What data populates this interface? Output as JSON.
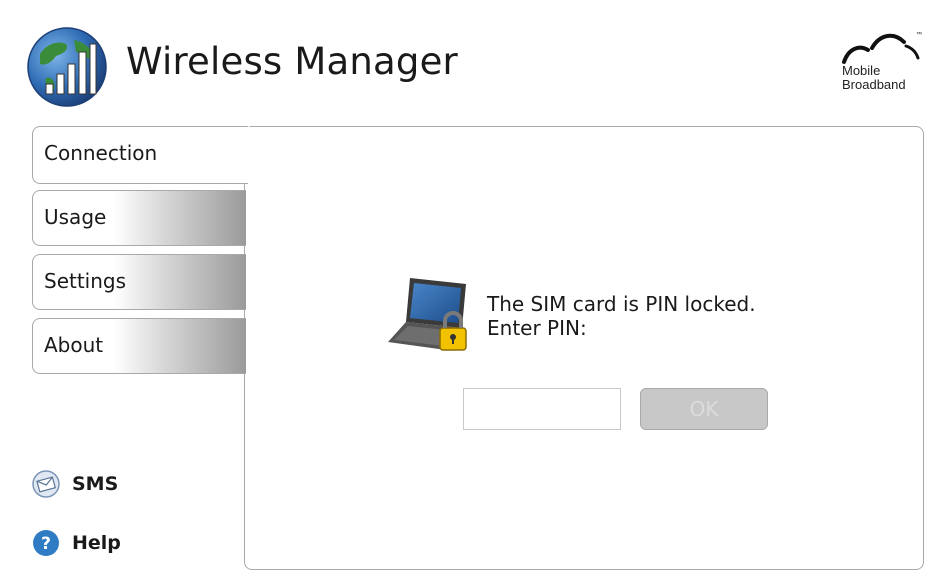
{
  "header": {
    "title": "Wireless Manager",
    "brand": {
      "line1": "Mobile",
      "line2": "Broadband"
    }
  },
  "tabs": [
    {
      "label": "Connection",
      "active": true
    },
    {
      "label": "Usage",
      "active": false
    },
    {
      "label": "Settings",
      "active": false
    },
    {
      "label": "About",
      "active": false
    }
  ],
  "side_links": {
    "sms": {
      "label": "SMS",
      "icon": "envelope-icon"
    },
    "help": {
      "label": "Help",
      "icon": "help-icon"
    }
  },
  "pin_dialog": {
    "message_line1": "The SIM card is PIN locked.",
    "message_line2": "Enter PIN:",
    "input_value": "",
    "ok_label": "OK",
    "ok_enabled": false,
    "icon": "laptop-lock-icon"
  },
  "colors": {
    "accent_blue": "#2f6db5",
    "globe_green": "#3b8c3a",
    "lock_yellow": "#f2c200",
    "border_gray": "#a9a9a9"
  }
}
